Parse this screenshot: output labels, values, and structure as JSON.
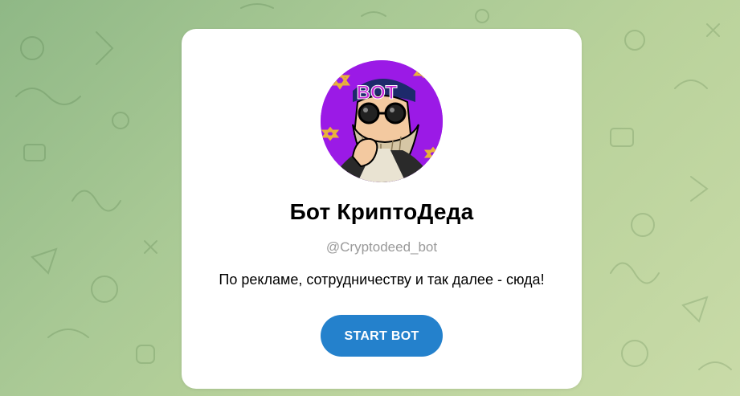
{
  "bot": {
    "avatar_text": "BOT",
    "name": "Бот КриптоДеда",
    "username": "@Cryptodeed_bot",
    "description": "По рекламе, сотрудничеству и так далее - сюда!",
    "start_label": "START BOT"
  },
  "colors": {
    "accent": "#2481cc",
    "avatar_bg": "#9b1ae6",
    "background": "#a9c995"
  },
  "icons": {
    "background_pattern": "doodle-pattern",
    "avatar": "old-man-sunglasses-avatar"
  }
}
